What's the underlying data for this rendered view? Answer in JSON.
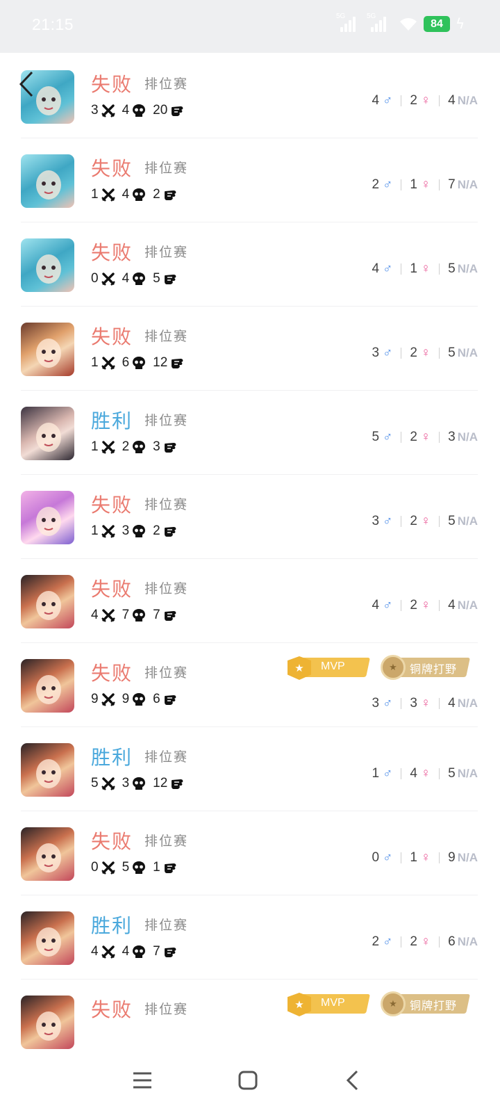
{
  "status_bar": {
    "time": "21:15",
    "signal_1_label": "5G",
    "signal_2_label": "5G",
    "battery": "84",
    "icons": [
      "signal-icon",
      "signal-icon",
      "wifi-icon",
      "battery-icon",
      "charging-icon"
    ]
  },
  "nav": {
    "back_icon": "back-arrow-icon"
  },
  "matches": [
    {
      "result": "失败",
      "outcome": "lose",
      "mode": "排位赛",
      "kills": "3",
      "deaths": "4",
      "assists": "20",
      "male": "4",
      "female": "2",
      "na_count": "4",
      "na_label": "N/A",
      "avatar_theme": "teal"
    },
    {
      "result": "失败",
      "outcome": "lose",
      "mode": "排位赛",
      "kills": "1",
      "deaths": "4",
      "assists": "2",
      "male": "2",
      "female": "1",
      "na_count": "7",
      "na_label": "N/A",
      "avatar_theme": "teal"
    },
    {
      "result": "失败",
      "outcome": "lose",
      "mode": "排位赛",
      "kills": "0",
      "deaths": "4",
      "assists": "5",
      "male": "4",
      "female": "1",
      "na_count": "5",
      "na_label": "N/A",
      "avatar_theme": "teal"
    },
    {
      "result": "失败",
      "outcome": "lose",
      "mode": "排位赛",
      "kills": "1",
      "deaths": "6",
      "assists": "12",
      "male": "3",
      "female": "2",
      "na_count": "5",
      "na_label": "N/A",
      "avatar_theme": "red"
    },
    {
      "result": "胜利",
      "outcome": "win",
      "mode": "排位赛",
      "kills": "1",
      "deaths": "2",
      "assists": "3",
      "male": "5",
      "female": "2",
      "na_count": "3",
      "na_label": "N/A",
      "avatar_theme": "dark"
    },
    {
      "result": "失败",
      "outcome": "lose",
      "mode": "排位赛",
      "kills": "1",
      "deaths": "3",
      "assists": "2",
      "male": "3",
      "female": "2",
      "na_count": "5",
      "na_label": "N/A",
      "avatar_theme": "pink"
    },
    {
      "result": "失败",
      "outcome": "lose",
      "mode": "排位赛",
      "kills": "4",
      "deaths": "7",
      "assists": "7",
      "male": "4",
      "female": "2",
      "na_count": "4",
      "na_label": "N/A",
      "avatar_theme": "girl"
    },
    {
      "result": "失败",
      "outcome": "lose",
      "mode": "排位赛",
      "kills": "9",
      "deaths": "9",
      "assists": "6",
      "male": "3",
      "female": "3",
      "na_count": "4",
      "na_label": "N/A",
      "avatar_theme": "girl",
      "badges": {
        "mvp": "MVP",
        "role": "铜牌打野"
      }
    },
    {
      "result": "胜利",
      "outcome": "win",
      "mode": "排位赛",
      "kills": "5",
      "deaths": "3",
      "assists": "12",
      "male": "1",
      "female": "4",
      "na_count": "5",
      "na_label": "N/A",
      "avatar_theme": "girl"
    },
    {
      "result": "失败",
      "outcome": "lose",
      "mode": "排位赛",
      "kills": "0",
      "deaths": "5",
      "assists": "1",
      "male": "0",
      "female": "1",
      "na_count": "9",
      "na_label": "N/A",
      "avatar_theme": "girl"
    },
    {
      "result": "胜利",
      "outcome": "win",
      "mode": "排位赛",
      "kills": "4",
      "deaths": "4",
      "assists": "7",
      "male": "2",
      "female": "2",
      "na_count": "6",
      "na_label": "N/A",
      "avatar_theme": "girl"
    },
    {
      "result": "失败",
      "outcome": "lose",
      "mode": "排位赛",
      "kills": "",
      "deaths": "",
      "assists": "",
      "male": "",
      "female": "",
      "na_count": "",
      "na_label": "",
      "avatar_theme": "girl",
      "badges": {
        "mvp": "MVP",
        "role": "铜牌打野"
      }
    }
  ],
  "gender_symbols": {
    "male": "♂",
    "female": "♀"
  },
  "colors": {
    "lose": "#ea7a6f",
    "win": "#4aa8dc",
    "male": "#4f8ee8",
    "female": "#ea5d9a",
    "na": "#b9bdc9",
    "mvp_gold": "#f3c24e",
    "bronze": "#dcbf86"
  },
  "nav_bar": {
    "icons": [
      "menu-icon",
      "home-icon",
      "back-icon"
    ]
  }
}
